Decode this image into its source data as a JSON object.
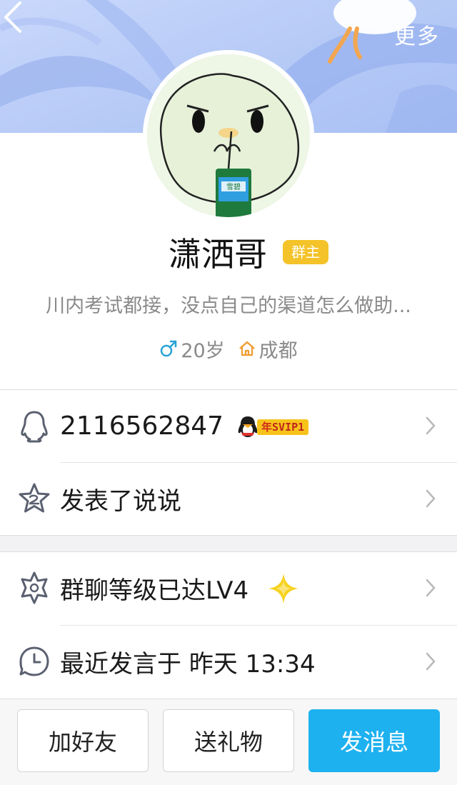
{
  "nav": {
    "more_label": "更多"
  },
  "profile": {
    "name": "潇洒哥",
    "role_badge": "群主",
    "signature": "川内考试都接，没点自己的渠道怎么做助...",
    "age": "20岁",
    "city": "成都",
    "drink_label": "雪碧"
  },
  "rows": {
    "qq_number": "2116562847",
    "vip_badge_prefix": "年",
    "vip_badge_text": "SVIP1",
    "moments_label": "发表了说说",
    "group_level_label": "群聊等级已达LV4",
    "last_speak_label": "最近发言于 昨天 13:34"
  },
  "actions": {
    "add_friend": "加好友",
    "send_gift": "送礼物",
    "send_message": "发消息"
  },
  "colors": {
    "accent_blue": "#1eb1f0",
    "badge_yellow": "#f4c329",
    "male_icon": "#29a3d6",
    "home_icon": "#f29a2e",
    "star_yellow": "#f7d21f"
  },
  "icons": [
    "back-arrow-icon",
    "qq-penguin-icon",
    "svip-penguin-icon",
    "moments-star-icon",
    "group-level-star-icon",
    "sparkle-icon",
    "clock-icon",
    "chevron-right-icon",
    "male-icon",
    "home-icon"
  ]
}
